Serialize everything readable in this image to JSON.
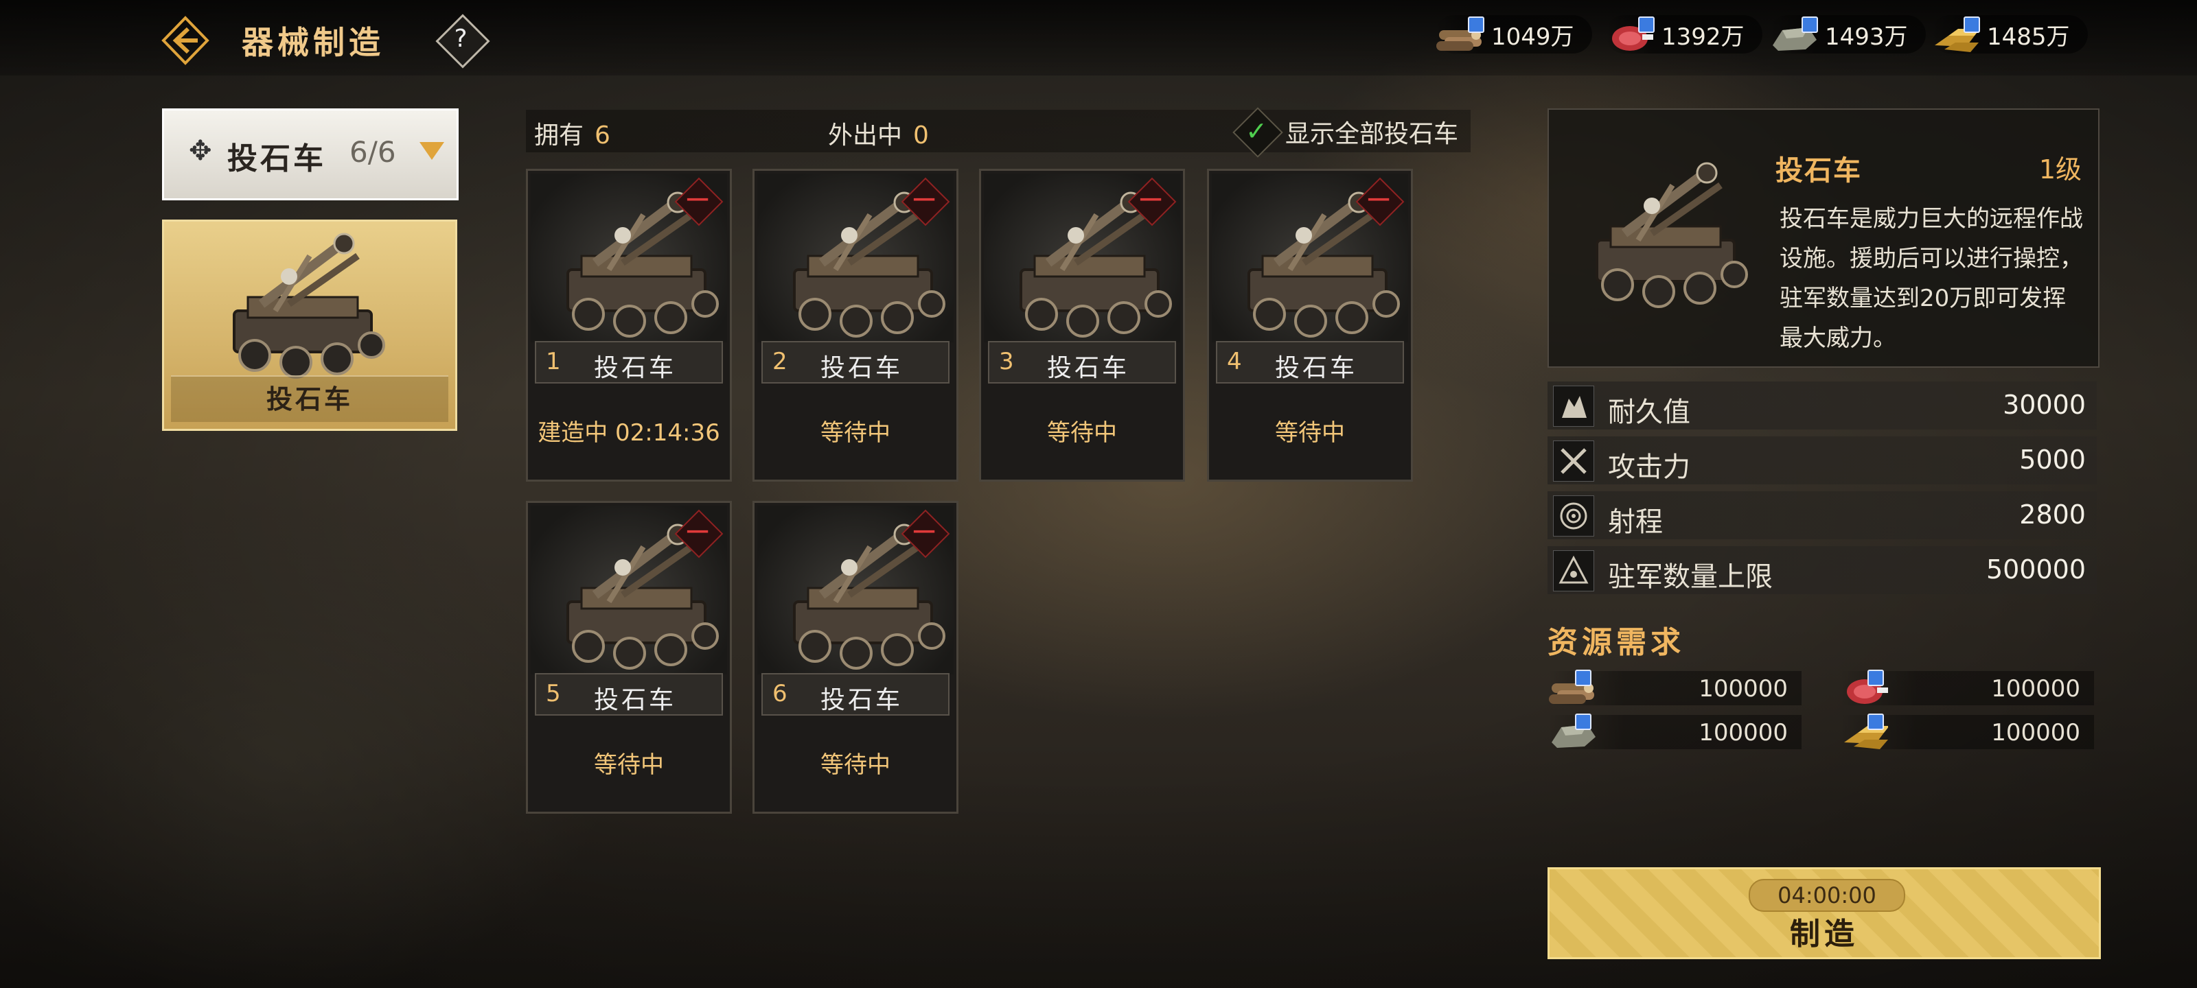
{
  "header": {
    "title": "器械制造",
    "help_label": "?"
  },
  "resources": [
    {
      "name": "wood-icon",
      "value": "1049万"
    },
    {
      "name": "meat-icon",
      "value": "1392万"
    },
    {
      "name": "stone-icon",
      "value": "1493万"
    },
    {
      "name": "gold-icon",
      "value": "1485万"
    }
  ],
  "sidebar": {
    "category": {
      "label": "投石车",
      "count": "6/6"
    },
    "item": {
      "label": "投石车"
    }
  },
  "summary": {
    "own_label": "拥有",
    "own_value": "6",
    "out_label": "外出中",
    "out_value": "0",
    "show_all_label": "显示全部投石车"
  },
  "cards": [
    {
      "no": "1",
      "name": "投石车",
      "status": "建造中 02:14:36",
      "minus": "一"
    },
    {
      "no": "2",
      "name": "投石车",
      "status": "等待中",
      "minus": "一"
    },
    {
      "no": "3",
      "name": "投石车",
      "status": "等待中",
      "minus": "一"
    },
    {
      "no": "4",
      "name": "投石车",
      "status": "等待中",
      "minus": "一"
    },
    {
      "no": "5",
      "name": "投石车",
      "status": "等待中",
      "minus": "一"
    },
    {
      "no": "6",
      "name": "投石车",
      "status": "等待中",
      "minus": "一"
    }
  ],
  "detail": {
    "name": "投石车",
    "level": "1级",
    "desc": "投石车是威力巨大的远程作战设施。援助后可以进行操控，驻军数量达到20万即可发挥最大威力。"
  },
  "stats": [
    {
      "icon": "durability-icon",
      "label": "耐久值",
      "value": "30000"
    },
    {
      "icon": "attack-icon",
      "label": "攻击力",
      "value": "5000"
    },
    {
      "icon": "range-icon",
      "label": "射程",
      "value": "2800"
    },
    {
      "icon": "garrison-icon",
      "label": "驻军数量上限",
      "value": "500000"
    }
  ],
  "requirements": {
    "title": "资源需求",
    "items": [
      {
        "icon": "wood-icon",
        "value": "100000"
      },
      {
        "icon": "meat-icon",
        "value": "100000"
      },
      {
        "icon": "stone-icon",
        "value": "100000"
      },
      {
        "icon": "gold-icon",
        "value": "100000"
      }
    ]
  },
  "make_button": {
    "time": "04:00:00",
    "label": "制造"
  }
}
